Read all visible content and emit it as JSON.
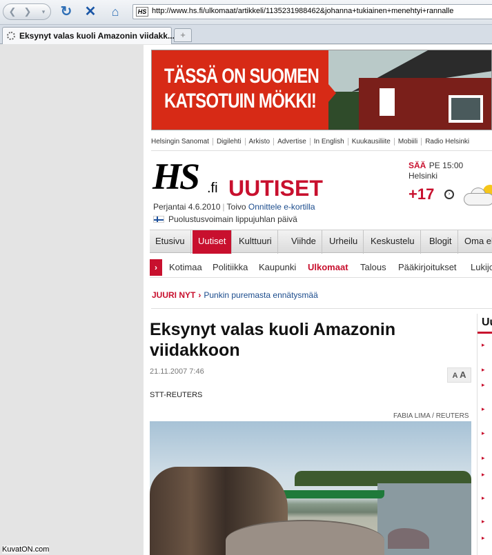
{
  "browser": {
    "url": "http://www.hs.fi/ulkomaat/artikkeli/1135231988462&johanna+tukiainen+menehtyi+rannalle",
    "url_favicon": "HS",
    "tab_title": "Eksynyt valas kuoli Amazonin viidakk...",
    "new_tab": "+"
  },
  "banner": {
    "line1": "TÄSSÄ ON SUOMEN",
    "line2": "KATSOTUIN MÖKKI!"
  },
  "top_links": [
    "Helsingin Sanomat",
    "Digilehti",
    "Arkisto",
    "Advertise",
    "In English",
    "Kuukausiliite",
    "Mobiili",
    "Radio Helsinki"
  ],
  "logo": {
    "hs": "HS",
    "fi": ".fi",
    "section": "UUTISET"
  },
  "dateline": {
    "date": "Perjantai 4.6.2010",
    "name": "Toivo",
    "link": "Onnittele e-kortilla"
  },
  "flag_text": "Puolustusvoimain lippujuhlan päivä",
  "weather": {
    "label": "SÄÄ",
    "time": "PE 15:00",
    "city": "Helsinki",
    "temp": "+17"
  },
  "main_nav": [
    "Etusivu",
    "Uutiset",
    "Kulttuuri",
    "Viihde",
    "Urheilu",
    "Keskustelu",
    "Blogit",
    "Oma elämä"
  ],
  "main_nav_active": "Uutiset",
  "sub_nav": [
    "Kotimaa",
    "Politiikka",
    "Kaupunki",
    "Ulkomaat",
    "Talous",
    "Pääkirjoitukset",
    "Lukijoilta"
  ],
  "sub_nav_active": "Ulkomaat",
  "juuri_nyt": {
    "label": "JUURI NYT",
    "link": "Punkin puremasta ennätysmää"
  },
  "article": {
    "headline": "Eksynyt valas kuoli Amazonin viidakkoon",
    "date": "21.11.2007 7:46",
    "font_small": "A",
    "font_large": "A",
    "source": "STT-REUTERS",
    "photo_credit": "FABIA LIMA / REUTERS"
  },
  "sidebar": {
    "heading": "Uu"
  },
  "watermark": "KuvatON.com",
  "colors": {
    "hs_red": "#c8102e",
    "link_blue": "#1a4b8c"
  }
}
